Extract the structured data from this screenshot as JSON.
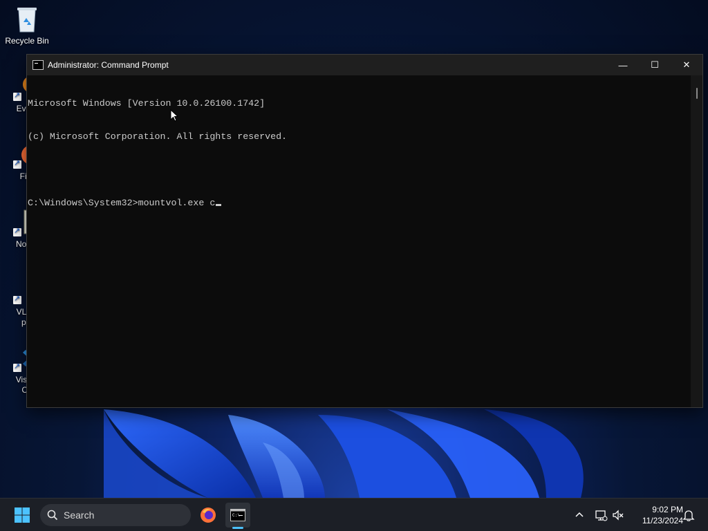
{
  "desktop": {
    "icons": [
      {
        "label": "Recycle Bin"
      },
      {
        "label": "Every"
      },
      {
        "label": "Fire"
      },
      {
        "label": "Notep"
      },
      {
        "label": "VLC r",
        "label2": "pla"
      },
      {
        "label": "Visual",
        "label2": "Co"
      }
    ]
  },
  "window": {
    "title": "Administrator: Command Prompt",
    "lines": [
      "Microsoft Windows [Version 10.0.26100.1742]",
      "(c) Microsoft Corporation. All rights reserved.",
      "",
      "C:\\Windows\\System32>mountvol.exe c"
    ],
    "minimize_glyph": "—",
    "maximize_glyph": "☐",
    "close_glyph": "✕"
  },
  "taskbar": {
    "search_placeholder": "Search",
    "apps": [
      "firefox-icon",
      "command-prompt-icon"
    ],
    "tray_icons": [
      "chevron-up-icon",
      "network-icon",
      "volume-muted-icon",
      "notification-bell-icon"
    ],
    "time": "9:02 PM",
    "date": "11/23/2024"
  },
  "colors": {
    "console_bg": "#0c0c0c",
    "console_text": "#cccccc",
    "titlebar_bg": "#1f1f1f",
    "taskbar_bg": "#1c1f26",
    "accent": "#4cc2ff"
  }
}
